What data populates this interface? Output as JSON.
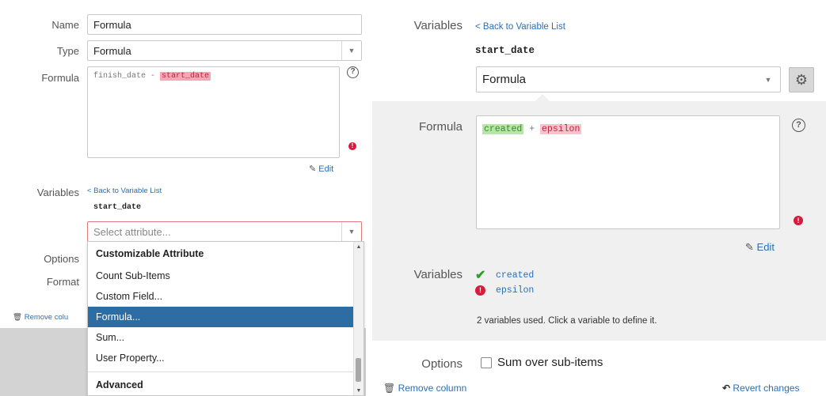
{
  "left": {
    "name_label": "Name",
    "name_value": "Formula",
    "type_label": "Type",
    "type_value": "Formula",
    "formula_label": "Formula",
    "formula_part1": "finish_date - ",
    "formula_part2": "start_date",
    "edit_label": "Edit",
    "variables_label": "Variables",
    "back_link": "< Back to Variable List",
    "var_name": "start_date",
    "select_placeholder": "Select attribute...",
    "options_label": "Options",
    "format_label": "Format",
    "remove_label": "Remove colu",
    "dropdown": {
      "group1": "Customizable Attribute",
      "items": [
        "Count Sub-Items",
        "Custom Field...",
        "Formula...",
        "Sum...",
        "User Property..."
      ],
      "selected": "Formula...",
      "group2": "Advanced"
    }
  },
  "right": {
    "variables_label": "Variables",
    "back_link": "< Back to Variable List",
    "var_name": "start_date",
    "type_value": "Formula",
    "formula_label": "Formula",
    "formula_var1": "created",
    "formula_op": " + ",
    "formula_var2": "epsilon",
    "edit_label": "Edit",
    "variables_list_label": "Variables",
    "var_items": [
      "created",
      "epsilon"
    ],
    "variables_hint": "2 variables used. Click a variable to define it.",
    "options_label": "Options",
    "sum_checkbox_label": "Sum over sub-items",
    "remove_label": "Remove column",
    "revert_label": "Revert changes"
  },
  "colors": {
    "link": "#2a6ebb",
    "selected_bg": "#2e6ca4",
    "error": "#d81b3c",
    "ok": "#2e9e2e",
    "highlight_red": "#f8a6b6",
    "highlight_green": "#b8e6a8"
  }
}
